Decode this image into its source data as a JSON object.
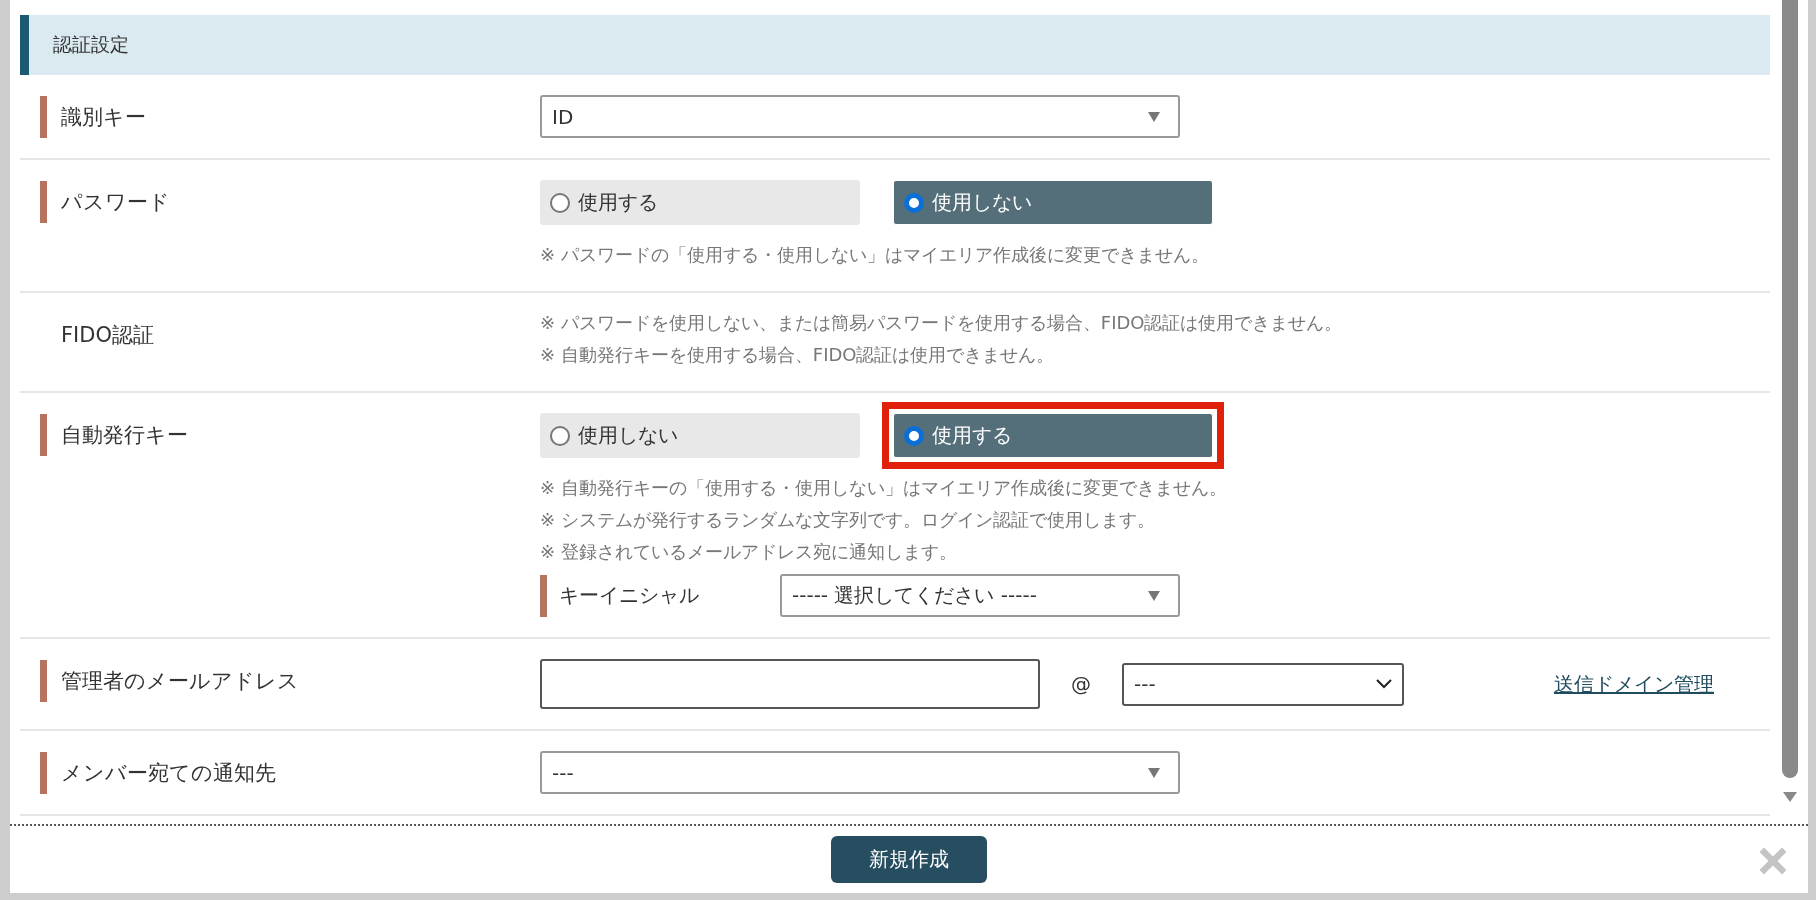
{
  "section": {
    "title": "認証設定"
  },
  "rows": [
    {
      "kind": "select",
      "label": "識別キー",
      "required": true,
      "value": "ID"
    },
    {
      "kind": "radio",
      "label": "パスワード",
      "required": true,
      "options": [
        {
          "label": "使用する",
          "selected": false,
          "highlighted": false
        },
        {
          "label": "使用しない",
          "selected": true,
          "highlighted": false
        }
      ],
      "notes": [
        "※ パスワードの「使用する・使用しない」はマイエリア作成後に変更できません。"
      ]
    },
    {
      "kind": "notes",
      "label": "FIDO認証",
      "required": false,
      "notes": [
        "※ パスワードを使用しない、または簡易パスワードを使用する場合、FIDO認証は使用できません。",
        "※ 自動発行キーを使用する場合、FIDO認証は使用できません。"
      ]
    },
    {
      "kind": "radio",
      "label": "自動発行キー",
      "required": true,
      "options": [
        {
          "label": "使用しない",
          "selected": false,
          "highlighted": false
        },
        {
          "label": "使用する",
          "selected": true,
          "highlighted": true
        }
      ],
      "notes": [
        "※ 自動発行キーの「使用する・使用しない」はマイエリア作成後に変更できません。",
        "※ システムが発行するランダムな文字列です。ログイン認証で使用します。",
        "※ 登録されているメールアドレス宛に通知します。"
      ],
      "sub_field": {
        "label": "キーイニシャル",
        "required": true,
        "value": "----- 選択してください -----"
      }
    },
    {
      "kind": "email",
      "label": "管理者のメールアドレス",
      "required": true,
      "at": "@",
      "domain": "---",
      "link": "送信ドメイン管理"
    },
    {
      "kind": "select",
      "label": "メンバー宛ての通知先",
      "required": true,
      "value": "---"
    }
  ],
  "footer": {
    "button": "新規作成"
  }
}
